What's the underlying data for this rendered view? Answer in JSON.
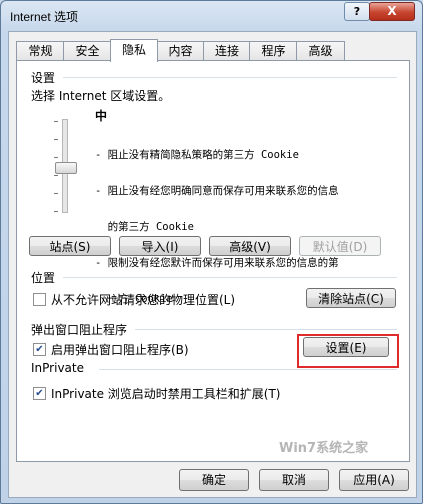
{
  "window": {
    "title": "Internet 选项"
  },
  "titlebar": {
    "help_label": "?",
    "close_label": "X"
  },
  "tabs": [
    {
      "label": "常规"
    },
    {
      "label": "安全"
    },
    {
      "label": "隐私",
      "active": true
    },
    {
      "label": "内容"
    },
    {
      "label": "连接"
    },
    {
      "label": "程序"
    },
    {
      "label": "高级"
    }
  ],
  "privacy": {
    "settings_heading": "设置",
    "zone_instruction": "选择 Internet 区域设置。",
    "level": "中",
    "slider_level": "中",
    "descriptions": [
      "- 阻止没有精简隐私策略的第三方 Cookie",
      "- 阻止没有经您明确同意而保存可用来联系您的信息",
      "  的第三方 Cookie",
      "- 限制没有经您默许而保存可用来联系您的信息的第",
      "  一方 Cookie"
    ],
    "buttons": {
      "sites": "站点(S)",
      "import": "导入(I)",
      "advanced": "高级(V)",
      "default": "默认值(D)"
    },
    "location_heading": "位置",
    "location_checkbox": "从不允许网站请求您的物理位置(L)",
    "location_checked": false,
    "clear_sites": "清除站点(C)",
    "popup_heading": "弹出窗口阻止程序",
    "popup_checkbox": "启用弹出窗口阻止程序(B)",
    "popup_checked": true,
    "popup_settings": "设置(E)",
    "inprivate_heading": "InPrivate",
    "inprivate_checkbox": "InPrivate 浏览启动时禁用工具栏和扩展(T)",
    "inprivate_checked": true
  },
  "footer": {
    "ok": "确定",
    "cancel": "取消",
    "apply": "应用(A)"
  },
  "watermark": "Win7系统之家",
  "colors": {
    "highlight": "#e02b2b",
    "title_bg": "#c7d8ec",
    "checkmark": "#2a4f8e"
  }
}
